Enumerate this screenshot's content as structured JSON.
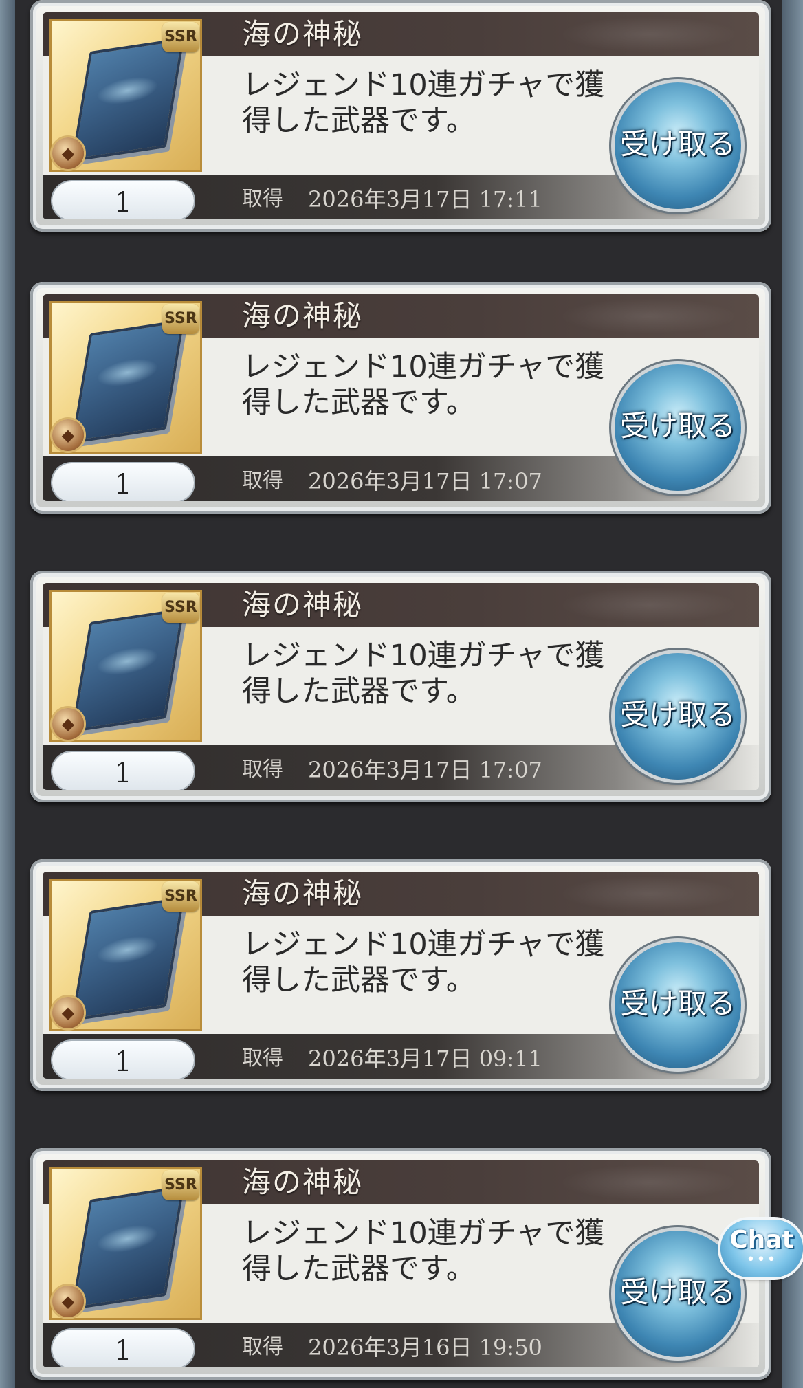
{
  "items": [
    {
      "title": "海の神秘",
      "description_line1": "レジェンド10連ガチャで獲",
      "description_line2": "得した武器です。",
      "quantity": "1",
      "acquired_label": "取得",
      "acquired_date": "2026年3月17日 17:11",
      "rarity": "SSR",
      "button_label": "受け取る"
    },
    {
      "title": "海の神秘",
      "description_line1": "レジェンド10連ガチャで獲",
      "description_line2": "得した武器です。",
      "quantity": "1",
      "acquired_label": "取得",
      "acquired_date": "2026年3月17日 17:07",
      "rarity": "SSR",
      "button_label": "受け取る"
    },
    {
      "title": "海の神秘",
      "description_line1": "レジェンド10連ガチャで獲",
      "description_line2": "得した武器です。",
      "quantity": "1",
      "acquired_label": "取得",
      "acquired_date": "2026年3月17日 17:07",
      "rarity": "SSR",
      "button_label": "受け取る"
    },
    {
      "title": "海の神秘",
      "description_line1": "レジェンド10連ガチャで獲",
      "description_line2": "得した武器です。",
      "quantity": "1",
      "acquired_label": "取得",
      "acquired_date": "2026年3月17日 09:11",
      "rarity": "SSR",
      "button_label": "受け取る"
    },
    {
      "title": "海の神秘",
      "description_line1": "レジェンド10連ガチャで獲",
      "description_line2": "得した武器です。",
      "quantity": "1",
      "acquired_label": "取得",
      "acquired_date": "2026年3月16日 19:50",
      "rarity": "SSR",
      "button_label": "受け取る"
    }
  ],
  "chat": {
    "label": "Chat",
    "dots": "•••"
  },
  "icons": {
    "item_image": "book-icon",
    "element": "element-icon",
    "chat": "chat-bubble-icon"
  },
  "colors": {
    "title_bar": "#3e3432",
    "button_blue": "#3e86b3",
    "thumb_gold": "#f4d98e"
  }
}
